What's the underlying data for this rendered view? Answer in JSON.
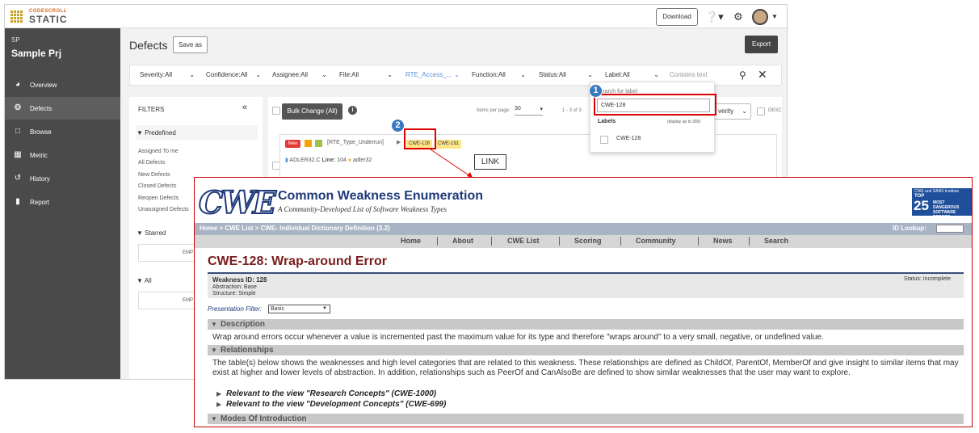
{
  "app": {
    "logo_small": "CODESCROLL",
    "logo_big": "STATIC",
    "download_label": "Download",
    "project_code": "SP",
    "project_name": "Sample Prj"
  },
  "sidebar": {
    "items": [
      {
        "label": "Overview",
        "icon": "compass-icon"
      },
      {
        "label": "Defects",
        "icon": "bug-icon"
      },
      {
        "label": "Browse",
        "icon": "folder-icon"
      },
      {
        "label": "Metric",
        "icon": "dashboard-icon"
      },
      {
        "label": "History",
        "icon": "history-icon"
      },
      {
        "label": "Report",
        "icon": "document-icon"
      }
    ]
  },
  "page": {
    "title": "Defects",
    "save_as": "Save as",
    "export": "Export"
  },
  "filters": {
    "severity": "Severity:All",
    "confidence": "Confidence:All",
    "assignee": "Assignee:All",
    "file": "File:All",
    "rte": "RTE_Access_...",
    "function": "Function:All",
    "status": "Status:All",
    "label": "Label:All",
    "contains_placeholder": "Contains text"
  },
  "filter_panel": {
    "title": "FILTERS",
    "predefined": "Predefined",
    "links": [
      "Assigned To me",
      "All Defects",
      "New Defects",
      "Closed Defects",
      "Reopen Defects",
      "Unassigned Defects"
    ],
    "starred": "Starred",
    "all": "All",
    "empty": "EMP"
  },
  "list": {
    "bulk_change": "Bulk Change (All)",
    "items_per_page_label": "Items per page:",
    "items_per_page": "30",
    "range": "1 - 3 of 3",
    "sort": "verity",
    "desc": "DESC"
  },
  "card": {
    "new": "New",
    "tag": "[RTE_Type_Underrun]",
    "label1": "CWE-128",
    "label2": "CWE-191",
    "file": "ADLER32.C",
    "line_label": "Line:",
    "line": "104",
    "func": "adler32"
  },
  "dropdown": {
    "hint": "Search for label",
    "query": "CWE-128",
    "labels_head": "Labels",
    "note": "(display up to 300)",
    "option": "CWE-128"
  },
  "annotations": {
    "badge1": "1",
    "badge2": "2",
    "link": "LINK"
  },
  "cwe": {
    "logo": "CWE",
    "title": "Common Weakness Enumeration",
    "subtitle": "A Community-Developed List of Software Weakness Types",
    "top25_line1": "CWE and SANS Institute",
    "top25_line2": "TOP",
    "top25_num": "25",
    "top25_line3": "MOST DANGEROUS",
    "top25_line4": "SOFTWARE",
    "top25_line5": "ERRORS",
    "breadcrumb": "Home > CWE List > CWE- Individual Dictionary Definition (3.2)",
    "id_lookup": "ID Lookup:",
    "nav": [
      "Home",
      "About",
      "CWE List",
      "Scoring",
      "Community",
      "News",
      "Search"
    ],
    "heading": "CWE-128: Wrap-around Error",
    "weakness_id": "Weakness ID: 128",
    "abstraction": "Abstraction: Base",
    "structure": "Structure: Simple",
    "status": "Status: Incomplete",
    "presentation_filter": "Presentation Filter:",
    "presentation_value": "Basic",
    "sec_description": "Description",
    "description": "Wrap around errors occur whenever a value is incremented past the maximum value for its type and therefore \"wraps around\" to a very small, negative, or undefined value.",
    "sec_relationships": "Relationships",
    "relationships": "The table(s) below shows the weaknesses and high level categories that are related to this weakness. These relationships are defined as ChildOf, ParentOf, MemberOf and give insight to similar items that may exist at higher and lower levels of abstraction. In addition, relationships such as PeerOf and CanAlsoBe are defined to show similar weaknesses that the user may want to explore.",
    "rel1": "Relevant to the view \"Research Concepts\" (CWE-1000)",
    "rel2": "Relevant to the view \"Development Concepts\" (CWE-699)",
    "sec_modes": "Modes Of Introduction"
  },
  "colors": {
    "sidebar": "#4a4a4a",
    "annotation_red": "#e00000",
    "badge_blue": "#3a78c2",
    "cwe_blue": "#1f3a7a",
    "cwe_heading": "#7a1c1c"
  }
}
